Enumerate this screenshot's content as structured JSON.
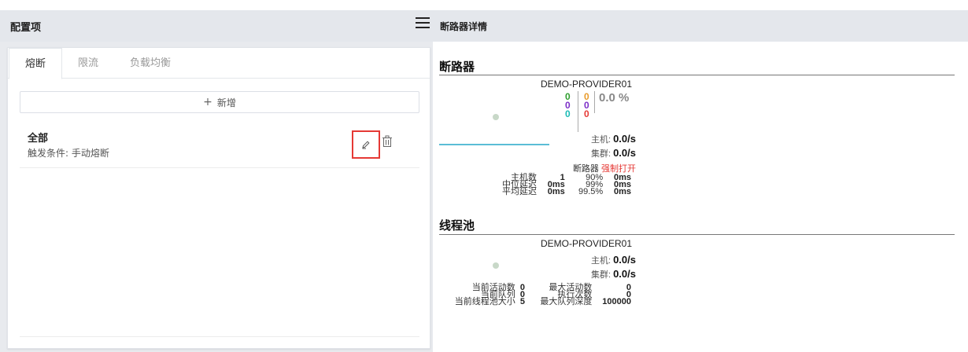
{
  "left": {
    "title": "配置项",
    "tabs": [
      {
        "label": "熔断",
        "active": true
      },
      {
        "label": "限流",
        "active": false
      },
      {
        "label": "负载均衡",
        "active": false
      }
    ],
    "add_label": "新增",
    "rule": {
      "title": "全部",
      "condition": "触发条件: 手动熔断"
    }
  },
  "right": {
    "title": "断路器详情",
    "circuit": {
      "section": "断路器",
      "name": "DEMO-PROVIDER01",
      "counts_col1": [
        "0",
        "0",
        "0"
      ],
      "counts_col2": [
        "0",
        "0",
        "0"
      ],
      "error_rate": "0.0 %",
      "host_label": "主机:",
      "host_rate": "0.0/s",
      "cluster_label": "集群:",
      "cluster_rate": "0.0/s",
      "breaker_label": "断路器",
      "breaker_status": "强制打开",
      "stats": {
        "rows": [
          {
            "label": "主机数",
            "value": "1",
            "pct": "90%",
            "pct_val": "0ms"
          },
          {
            "label": "中位延迟",
            "value": "0ms",
            "pct": "99%",
            "pct_val": "0ms"
          },
          {
            "label": "平均延迟",
            "value": "0ms",
            "pct": "99.5%",
            "pct_val": "0ms"
          }
        ]
      },
      "colors": {
        "c1": "#2e9e2e",
        "c2": "#7b2ec7",
        "c3": "#1bbbb5",
        "c4": "#e89a2a",
        "c5": "#7b2ec7",
        "c6": "#e53935"
      }
    },
    "threadpool": {
      "section": "线程池",
      "name": "DEMO-PROVIDER01",
      "host_label": "主机:",
      "host_rate": "0.0/s",
      "cluster_label": "集群:",
      "cluster_rate": "0.0/s",
      "rows": [
        {
          "l1": "当前活动数",
          "v1": "0",
          "l2": "最大活动数",
          "v2": "0"
        },
        {
          "l1": "当前队列",
          "v1": "0",
          "l2": "执行次数",
          "v2": "0"
        },
        {
          "l1": "当前线程池大小",
          "v1": "5",
          "l2": "最大队列深度",
          "v2": "100000"
        }
      ]
    }
  },
  "icons": {
    "edit": "pencil-icon",
    "delete": "trash-icon",
    "menu": "hamburger-icon",
    "plus": "plus-icon"
  }
}
